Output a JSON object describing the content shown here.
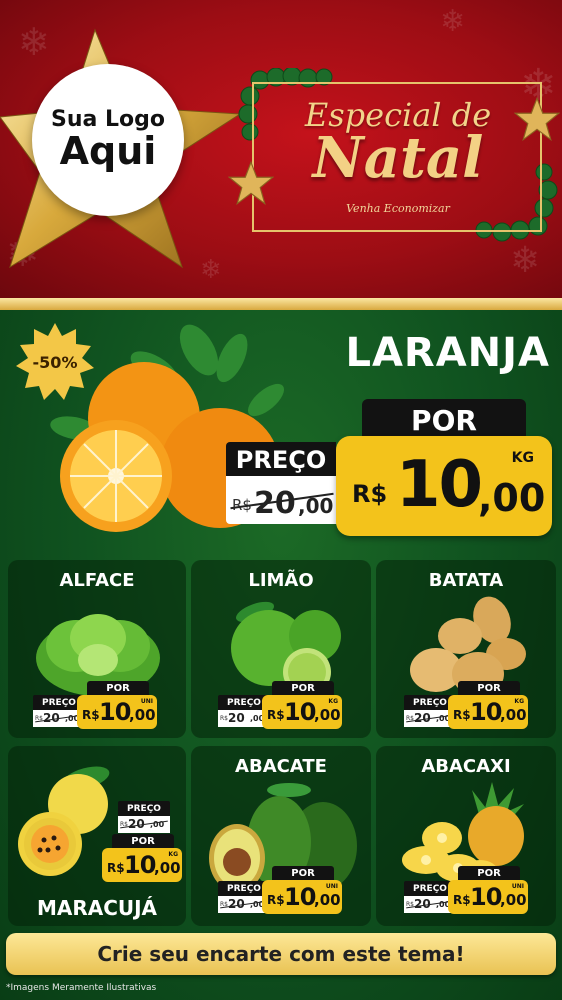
{
  "header": {
    "logo_line1": "Sua Logo",
    "logo_line2": "Aqui",
    "title_line1": "Especial de",
    "title_line2": "Natal",
    "subtitle": "Venha Economizar"
  },
  "hero": {
    "discount": "-50%",
    "name": "LARANJA",
    "por_label": "POR",
    "preco_label": "PREÇO",
    "old_currency": "R$",
    "old_int": "20",
    "old_cents": ",00",
    "currency": "R$",
    "price_int": "10",
    "price_cents": ",00",
    "unit": "KG"
  },
  "products": [
    {
      "name": "ALFACE",
      "preco_label": "PREÇO",
      "old_currency": "R$",
      "old_int": "20",
      "old_cents": ",00",
      "por_label": "POR",
      "currency": "R$",
      "price_int": "10",
      "price_cents": ",00",
      "unit": "UNI"
    },
    {
      "name": "LIMÃO",
      "preco_label": "PREÇO",
      "old_currency": "R$",
      "old_int": "20",
      "old_cents": ",00",
      "por_label": "POR",
      "currency": "R$",
      "price_int": "10",
      "price_cents": ",00",
      "unit": "KG"
    },
    {
      "name": "BATATA",
      "preco_label": "PREÇO",
      "old_currency": "R$",
      "old_int": "20",
      "old_cents": ",00",
      "por_label": "POR",
      "currency": "R$",
      "price_int": "10",
      "price_cents": ",00",
      "unit": "KG"
    },
    {
      "name": "MARACUJÁ",
      "preco_label": "PREÇO",
      "old_currency": "R$",
      "old_int": "20",
      "old_cents": ",00",
      "por_label": "POR",
      "currency": "R$",
      "price_int": "10",
      "price_cents": ",00",
      "unit": "KG"
    },
    {
      "name": "ABACATE",
      "preco_label": "PREÇO",
      "old_currency": "R$",
      "old_int": "20",
      "old_cents": ",00",
      "por_label": "POR",
      "currency": "R$",
      "price_int": "10",
      "price_cents": ",00",
      "unit": "UNI"
    },
    {
      "name": "ABACAXI",
      "preco_label": "PREÇO",
      "old_currency": "R$",
      "old_int": "20",
      "old_cents": ",00",
      "por_label": "POR",
      "currency": "R$",
      "price_int": "10",
      "price_cents": ",00",
      "unit": "UNI"
    }
  ],
  "cta": "Crie seu encarte com este tema!",
  "disclaimer": "*Imagens Meramente Ilustrativas",
  "colors": {
    "header_red": "#b0101a",
    "green": "#105320",
    "gold": "#f3c31b",
    "black_tab": "#121212"
  }
}
